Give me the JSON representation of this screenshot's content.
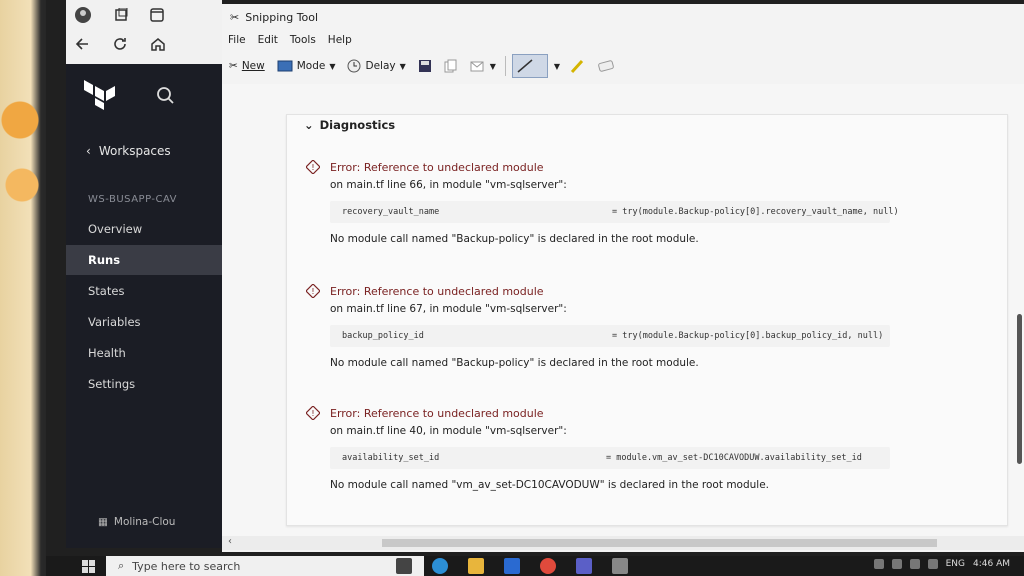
{
  "snipping_tool": {
    "title": "Snipping Tool",
    "menu": [
      "File",
      "Edit",
      "Tools",
      "Help"
    ],
    "toolbar": {
      "new": "New",
      "mode": "Mode",
      "delay": "Delay"
    }
  },
  "terraform": {
    "back_label": "Workspaces",
    "workspace_name": "WS-BUSAPP-CAV",
    "nav": [
      "Overview",
      "Runs",
      "States",
      "Variables",
      "Health",
      "Settings"
    ],
    "active_nav": "Runs",
    "org_name": "Molina-Clou"
  },
  "diagnostics": {
    "heading": "Diagnostics",
    "errors": [
      {
        "title": "Error: Reference to undeclared module",
        "location": "on main.tf line 66, in module \"vm-sqlserver\":",
        "code_left": "recovery_vault_name",
        "code_right": "= try(module.Backup-policy[0].recovery_vault_name, null)",
        "message": "No module call named \"Backup-policy\" is declared in the root module."
      },
      {
        "title": "Error: Reference to undeclared module",
        "location": "on main.tf line 67, in module \"vm-sqlserver\":",
        "code_left": "backup_policy_id",
        "code_right": "= try(module.Backup-policy[0].backup_policy_id, null)",
        "message": "No module call named \"Backup-policy\" is declared in the root module."
      },
      {
        "title": "Error: Reference to undeclared module",
        "location": "on main.tf line 40, in module \"vm-sqlserver\":",
        "code_left": "availability_set_id",
        "code_right": "= module.vm_av_set-DC10CAVODUW.availability_set_id",
        "message": "No module call named \"vm_av_set-DC10CAVODUW\" is declared in the root module."
      }
    ]
  },
  "taskbar": {
    "search_placeholder": "Type here to search",
    "language": "ENG",
    "time": "4:46 AM"
  }
}
